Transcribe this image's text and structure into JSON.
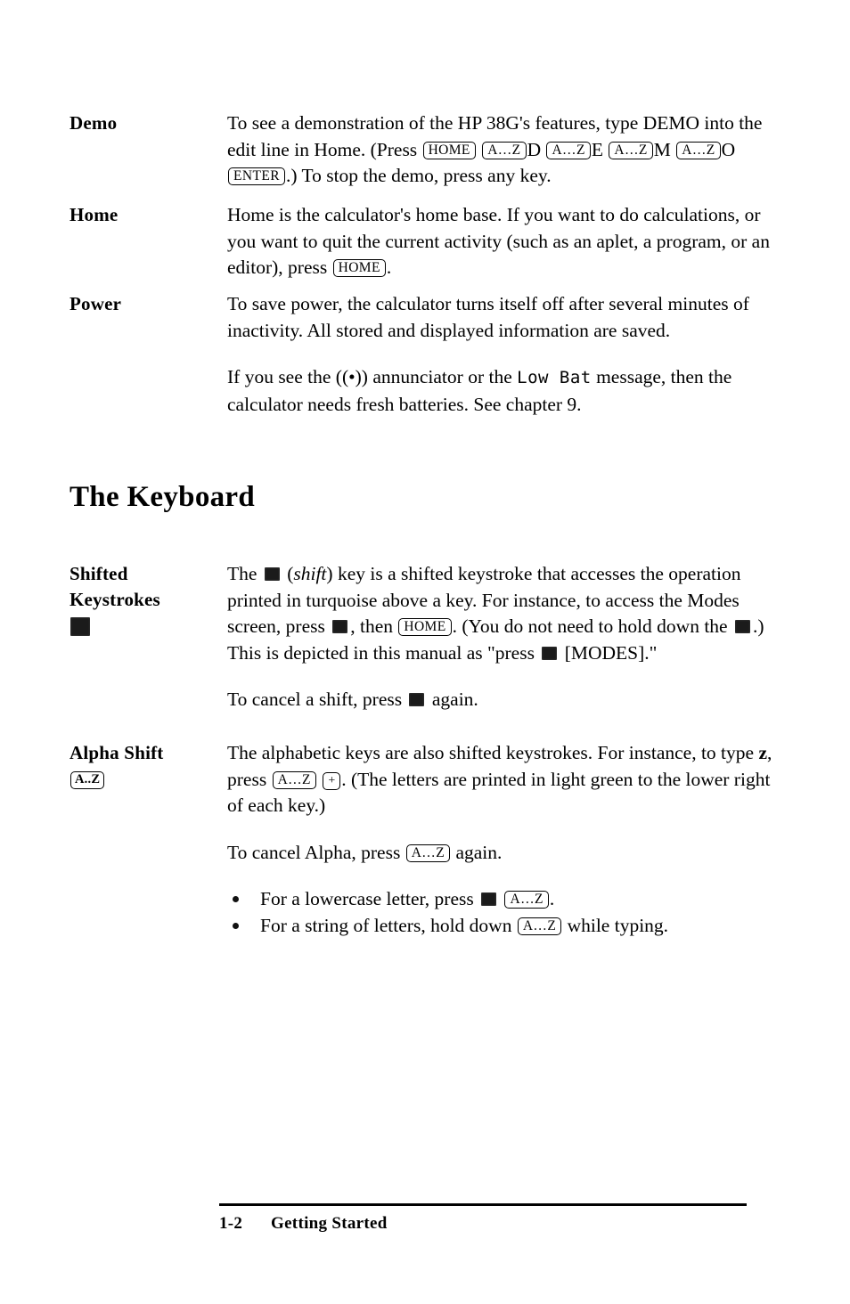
{
  "page": {
    "number": "1-2",
    "footer_title": "Getting Started"
  },
  "entries": [
    {
      "term": "Demo",
      "paragraphs": [
        {
          "parts": [
            {
              "t": "text",
              "v": "To see a demonstration of the HP 38G's features, type DEMO into the edit line in Home. (Press "
            },
            {
              "t": "key",
              "v": "HOME"
            },
            {
              "t": "text",
              "v": " "
            },
            {
              "t": "key",
              "v": "A…Z"
            },
            {
              "t": "text",
              "v": "D "
            },
            {
              "t": "key",
              "v": "A…Z"
            },
            {
              "t": "text",
              "v": "E "
            },
            {
              "t": "key",
              "v": "A…Z"
            },
            {
              "t": "text",
              "v": "M "
            },
            {
              "t": "key",
              "v": "A…Z"
            },
            {
              "t": "text",
              "v": "O "
            },
            {
              "t": "key",
              "v": "ENTER"
            },
            {
              "t": "text",
              "v": ".) To stop the demo, press any key."
            }
          ]
        }
      ]
    },
    {
      "term": "Home",
      "paragraphs": [
        {
          "parts": [
            {
              "t": "text",
              "v": "Home is the calculator's home base. If you want to do calculations, or you want to quit the current activity (such as an aplet, a program, or an editor), press "
            },
            {
              "t": "key",
              "v": "HOME"
            },
            {
              "t": "text",
              "v": "."
            }
          ]
        }
      ]
    },
    {
      "term": "Power",
      "paragraphs": [
        {
          "parts": [
            {
              "t": "text",
              "v": "To save power, the calculator turns itself off after several minutes of inactivity. All stored and displayed information are saved."
            }
          ]
        },
        {
          "parts": [
            {
              "t": "text",
              "v": "If you see the ((•)) annunciator or the "
            },
            {
              "t": "mono",
              "v": "Low Bat"
            },
            {
              "t": "text",
              "v": " message, then the calculator needs fresh batteries. See chapter 9."
            }
          ]
        }
      ]
    }
  ],
  "heading": "The Keyboard",
  "keyboard_entries": [
    {
      "term_lines": [
        "Shifted",
        "Keystrokes"
      ],
      "term_glyph": "shift-key-icon",
      "paragraphs": [
        {
          "parts": [
            {
              "t": "text",
              "v": "The "
            },
            {
              "t": "shift",
              "v": ""
            },
            {
              "t": "text",
              "v": " ("
            },
            {
              "t": "ital",
              "v": "shift"
            },
            {
              "t": "text",
              "v": ") key is a shifted keystroke that accesses the operation printed in turquoise above a key. For instance, to access the Modes screen, press "
            },
            {
              "t": "shift",
              "v": ""
            },
            {
              "t": "text",
              "v": ", then "
            },
            {
              "t": "key",
              "v": "HOME"
            },
            {
              "t": "text",
              "v": ". (You do not need to hold down the "
            },
            {
              "t": "shift",
              "v": ""
            },
            {
              "t": "text",
              "v": ".) This is depicted in this manual as \"press "
            },
            {
              "t": "shift",
              "v": ""
            },
            {
              "t": "text",
              "v": " [MODES].\""
            }
          ]
        },
        {
          "parts": [
            {
              "t": "text",
              "v": "To cancel a shift, press "
            },
            {
              "t": "shift",
              "v": ""
            },
            {
              "t": "text",
              "v": " again."
            }
          ]
        }
      ]
    },
    {
      "term_lines": [
        "Alpha Shift"
      ],
      "term_key": "A..Z",
      "paragraphs": [
        {
          "parts": [
            {
              "t": "text",
              "v": "The alphabetic keys are also shifted keystrokes. For instance, to type "
            },
            {
              "t": "bold",
              "v": "z"
            },
            {
              "t": "text",
              "v": ", press "
            },
            {
              "t": "key",
              "v": "A…Z"
            },
            {
              "t": "text",
              "v": " "
            },
            {
              "t": "keyplus",
              "v": "+"
            },
            {
              "t": "text",
              "v": ".  (The letters are printed in light green to the lower right of each key.)"
            }
          ]
        },
        {
          "parts": [
            {
              "t": "text",
              "v": "To cancel Alpha, press "
            },
            {
              "t": "key",
              "v": "A…Z"
            },
            {
              "t": "text",
              "v": " again."
            }
          ]
        }
      ],
      "bullets": [
        {
          "parts": [
            {
              "t": "text",
              "v": "For a lowercase letter, press "
            },
            {
              "t": "shift",
              "v": ""
            },
            {
              "t": "text",
              "v": " "
            },
            {
              "t": "key",
              "v": "A…Z"
            },
            {
              "t": "text",
              "v": "."
            }
          ]
        },
        {
          "parts": [
            {
              "t": "text",
              "v": "For a string of letters, hold down "
            },
            {
              "t": "key",
              "v": "A…Z"
            },
            {
              "t": "text",
              "v": " while typing."
            }
          ]
        }
      ]
    }
  ]
}
